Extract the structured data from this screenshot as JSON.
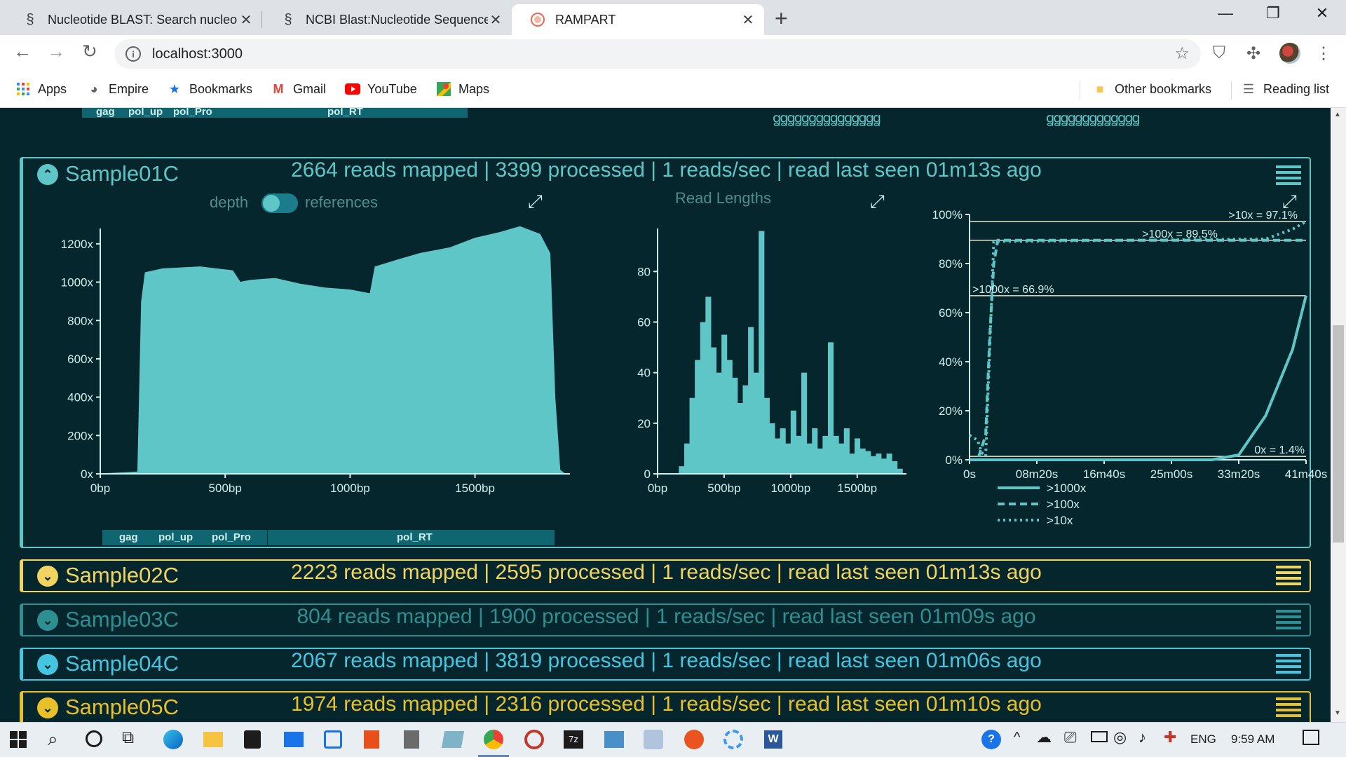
{
  "browser": {
    "tabs": [
      {
        "title": "Nucleotide BLAST: Search nucleo",
        "close": "✕",
        "icon": "dna-icon"
      },
      {
        "title": "NCBI Blast:Nucleotide Sequence",
        "close": "✕",
        "icon": "dna-icon"
      },
      {
        "title": "RAMPART",
        "close": "✕",
        "icon": "rampart-icon"
      }
    ],
    "new_tab": "+",
    "url": "localhost:3000",
    "bookmarks": [
      {
        "label": "Apps",
        "icon": "apps-grid-icon"
      },
      {
        "label": "Empire",
        "icon": "globe-icon"
      },
      {
        "label": "Bookmarks",
        "icon": "star-icon"
      },
      {
        "label": "Gmail",
        "icon": "gmail-icon"
      },
      {
        "label": "YouTube",
        "icon": "youtube-icon"
      },
      {
        "label": "Maps",
        "icon": "maps-icon"
      }
    ],
    "other_bookmarks": "Other bookmarks",
    "reading_list": "Reading list"
  },
  "genome_track": {
    "genes": [
      "gag",
      "pol_up",
      "pol_Pro",
      "pol_RT"
    ]
  },
  "samples": [
    {
      "name": "Sample01C",
      "stats": "2664 reads mapped | 3399 processed | 1 reads/sec | read last seen 01m13s ago",
      "color": "#5ec6c6",
      "expanded": true
    },
    {
      "name": "Sample02C",
      "stats": "2223 reads mapped | 2595 processed | 1 reads/sec | read last seen 01m13s ago",
      "color": "#f2d460",
      "expanded": false
    },
    {
      "name": "Sample03C",
      "stats": "804 reads mapped | 1900 processed | 1 reads/sec | read last seen 01m09s ago",
      "color": "#2e8f92",
      "expanded": false
    },
    {
      "name": "Sample04C",
      "stats": "2067 reads mapped | 3819 processed | 1 reads/sec | read last seen 01m06s ago",
      "color": "#46c5e0",
      "expanded": false
    },
    {
      "name": "Sample05C",
      "stats": "1974 reads mapped | 2316 processed | 1 reads/sec | read last seen 01m10s ago",
      "color": "#e8c12a",
      "expanded": false
    }
  ],
  "depth_toggle": {
    "left": "depth",
    "right": "references"
  },
  "chart_data": [
    {
      "type": "area",
      "xlabel": "",
      "ylabel": "",
      "x_ticks": [
        "0bp",
        "500bp",
        "1000bp",
        "1500bp"
      ],
      "y_ticks": [
        "0x",
        "200x",
        "400x",
        "600x",
        "800x",
        "1000x",
        "1200x"
      ],
      "xlim": [
        0,
        1880
      ],
      "ylim": [
        0,
        1280
      ],
      "x": [
        0,
        150,
        165,
        180,
        250,
        400,
        530,
        560,
        600,
        700,
        800,
        900,
        1000,
        1080,
        1100,
        1200,
        1280,
        1400,
        1500,
        1600,
        1680,
        1760,
        1800,
        1820,
        1840,
        1860,
        1880
      ],
      "y": [
        0,
        10,
        900,
        1050,
        1070,
        1080,
        1060,
        1000,
        1010,
        1020,
        990,
        970,
        960,
        940,
        1080,
        1120,
        1150,
        1180,
        1230,
        1260,
        1290,
        1250,
        1150,
        400,
        20,
        0,
        0
      ]
    },
    {
      "type": "bar",
      "title": "Read Lengths",
      "x_ticks": [
        "0bp",
        "500bp",
        "1000bp",
        "1500bp"
      ],
      "y_ticks": [
        "0",
        "20",
        "40",
        "60",
        "80"
      ],
      "xlim": [
        0,
        1870
      ],
      "ylim": [
        0,
        97
      ],
      "x": [
        160,
        200,
        240,
        280,
        320,
        360,
        400,
        440,
        480,
        520,
        560,
        600,
        640,
        680,
        720,
        760,
        800,
        840,
        880,
        920,
        960,
        1000,
        1040,
        1080,
        1120,
        1160,
        1200,
        1240,
        1280,
        1320,
        1360,
        1400,
        1440,
        1480,
        1520,
        1560,
        1600,
        1640,
        1680,
        1720,
        1760,
        1800
      ],
      "values": [
        3,
        12,
        30,
        45,
        60,
        70,
        50,
        40,
        55,
        45,
        38,
        28,
        35,
        58,
        40,
        96,
        30,
        20,
        14,
        18,
        12,
        25,
        15,
        40,
        12,
        18,
        10,
        15,
        52,
        15,
        12,
        18,
        8,
        14,
        10,
        9,
        7,
        8,
        6,
        8,
        5,
        2
      ]
    },
    {
      "type": "line",
      "x_ticks": [
        "0s",
        "08m20s",
        "16m40s",
        "25m00s",
        "33m20s",
        "41m40s"
      ],
      "y_ticks": [
        "0%",
        "20%",
        "40%",
        "60%",
        "80%",
        "100%"
      ],
      "ylim": [
        0,
        100
      ],
      "series": [
        {
          "name": ">1000x",
          "style": "solid",
          "x_s": [
            0,
            1500,
            1800,
            2000,
            2200,
            2400,
            2500
          ],
          "y": [
            0,
            0,
            0,
            2,
            18,
            45,
            67
          ]
        },
        {
          "name": ">100x",
          "style": "dashed",
          "x_s": [
            0,
            60,
            120,
            150,
            180,
            210,
            2500
          ],
          "y": [
            0,
            0,
            10,
            50,
            80,
            89.5,
            89.5
          ]
        },
        {
          "name": ">10x",
          "style": "dotted",
          "x_s": [
            0,
            60,
            90,
            120,
            180,
            2200,
            2400,
            2500
          ],
          "y": [
            10,
            8,
            3,
            1.4,
            89,
            90,
            94,
            97.1
          ]
        }
      ],
      "annotations": [
        ">10x = 97.1%",
        ">100x = 89.5%",
        ">1000x = 66.9%",
        "0x = 1.4%"
      ],
      "legend": [
        ">1000x",
        ">100x",
        ">10x"
      ]
    }
  ],
  "taskbar": {
    "language": "ENG",
    "time": "9:59 AM"
  }
}
